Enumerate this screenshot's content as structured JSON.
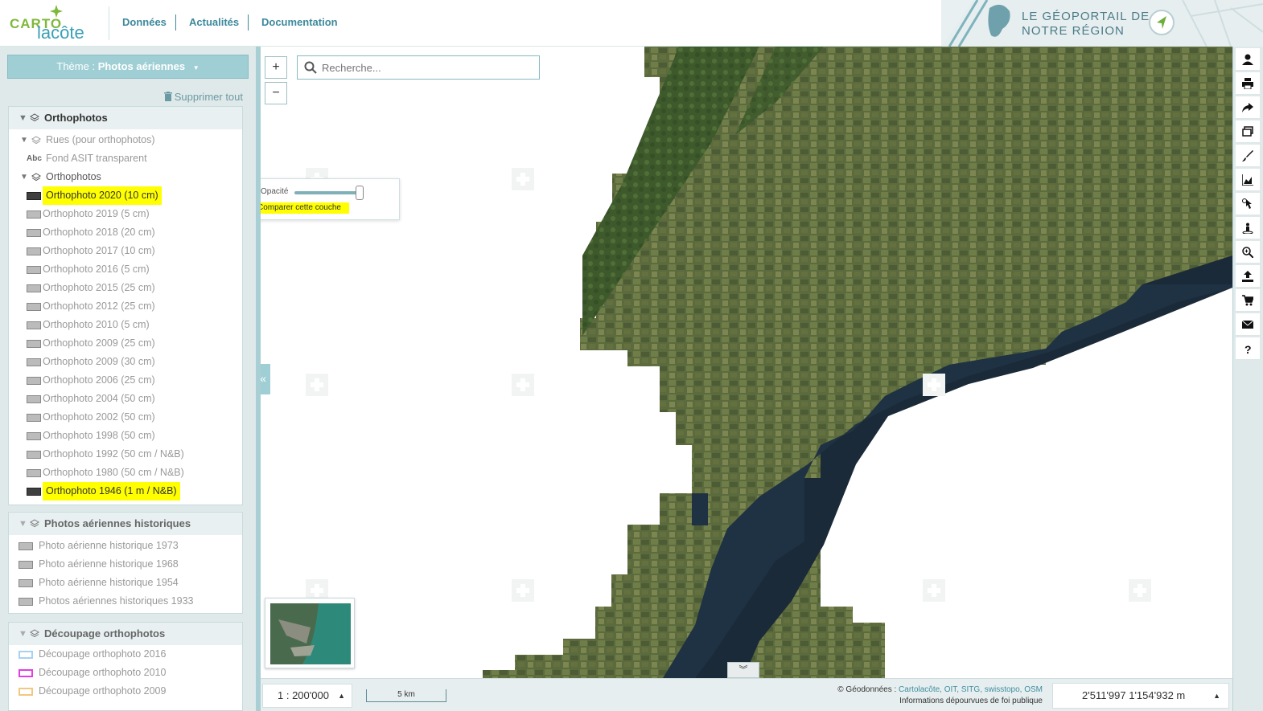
{
  "header": {
    "logo_top": "CARTO",
    "logo_bottom": "lacôte",
    "nav": [
      {
        "label": "Données"
      },
      {
        "label": "Actualités"
      },
      {
        "label": "Documentation"
      }
    ],
    "banner_title": "LE GÉOPORTAIL DE\nNOTRE RÉGION"
  },
  "sidebar": {
    "theme_prefix": "Thème : ",
    "theme_value": "Photos aériennes",
    "delete_all": "Supprimer tout",
    "orthophotos_panel": {
      "title": "Orthophotos",
      "groups": [
        {
          "label": "Rues (pour orthophotos)"
        },
        {
          "label": "Fond ASIT transparent"
        },
        {
          "label": "Orthophotos"
        }
      ],
      "layers": [
        {
          "label": "Orthophoto 2020 (10 cm)",
          "active": true
        },
        {
          "label": "Orthophoto 2019 (5 cm)"
        },
        {
          "label": "Orthophoto 2018 (20 cm)"
        },
        {
          "label": "Orthophoto 2017 (10 cm)"
        },
        {
          "label": "Orthophoto 2016 (5 cm)"
        },
        {
          "label": "Orthophoto 2015 (25 cm)"
        },
        {
          "label": "Orthophoto 2012 (25 cm)"
        },
        {
          "label": "Orthophoto 2010 (5 cm)"
        },
        {
          "label": "Orthophoto 2009 (25 cm)"
        },
        {
          "label": "Orthophoto 2009 (30 cm)"
        },
        {
          "label": "Orthophoto 2006 (25 cm)"
        },
        {
          "label": "Orthophoto 2004 (50 cm)"
        },
        {
          "label": "Orthophoto 2002 (50 cm)"
        },
        {
          "label": "Orthophoto 1998 (50 cm)"
        },
        {
          "label": "Orthophoto 1992 (50 cm / N&B)"
        },
        {
          "label": "Orthophoto 1980 (50 cm / N&B)"
        },
        {
          "label": "Orthophoto 1946 (1 m / N&B)",
          "active": true
        }
      ]
    },
    "historic_panel": {
      "title": "Photos aériennes historiques",
      "layers": [
        {
          "label": "Photo aérienne historique 1973"
        },
        {
          "label": "Photo aérienne historique 1968"
        },
        {
          "label": "Photo aérienne historique 1954"
        },
        {
          "label": "Photos aériennes historiques 1933"
        }
      ]
    },
    "cutting_panel": {
      "title": "Découpage orthophotos",
      "layers": [
        {
          "label": "Découpage orthophoto 2016",
          "color": "#a9d1f0"
        },
        {
          "label": "Découpage orthophoto 2010",
          "color": "#e23ee2"
        },
        {
          "label": "Découpage orthophoto 2009",
          "color": "#f1c880"
        }
      ]
    }
  },
  "map": {
    "search_placeholder": "Recherche...",
    "zoom_in": "+",
    "zoom_out": "−",
    "opacity_label": "Opacité",
    "opacity_value": 1.0,
    "compare_label": "Comparer cette couche",
    "collapse_label": "«",
    "expand_footer": "»"
  },
  "toolbar": {
    "icons": [
      "user-icon",
      "print-icon",
      "share-icon",
      "layers-window-icon",
      "draw-icon",
      "profile-chart-icon",
      "select-icon",
      "streetview-icon",
      "zoom-search-icon",
      "upload-icon",
      "cart-icon",
      "mail-icon",
      "help-icon"
    ]
  },
  "footer": {
    "scale": "1 : 200'000",
    "scalebar": "5 km",
    "attrib_prefix": "© Géodonnées : ",
    "attrib_links": "Cartolacôte, OIT, SITG, swisstopo, OSM",
    "attrib_note": "Informations dépourvues de foi publique",
    "coords": "2'511'997 1'154'932 m"
  }
}
